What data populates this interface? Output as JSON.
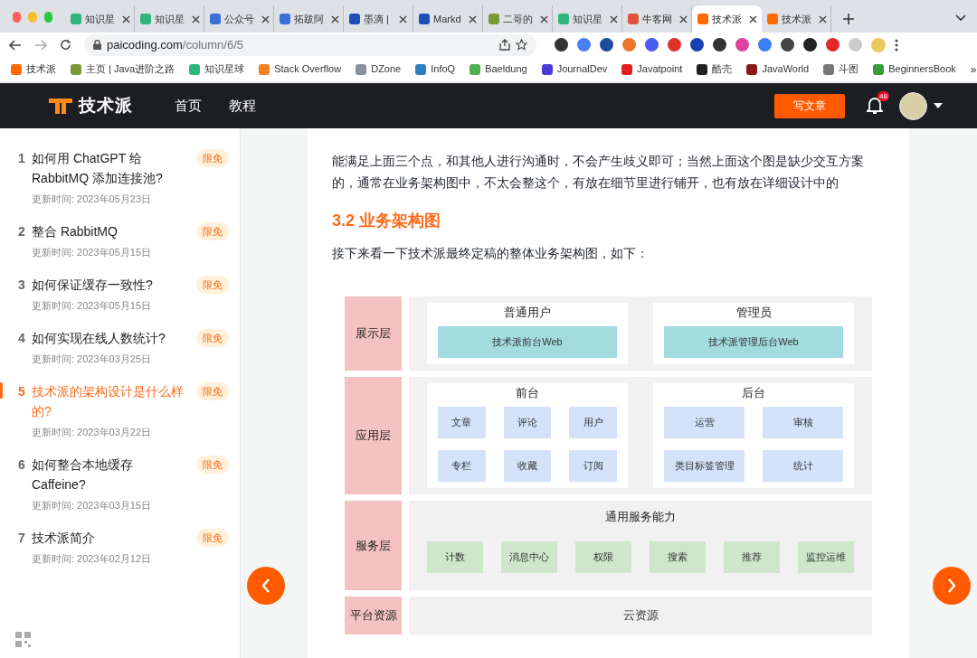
{
  "browser": {
    "tabs": [
      {
        "title": "知识星",
        "selected": false,
        "color": "#2fb67c"
      },
      {
        "title": "知识星",
        "selected": false,
        "color": "#2fb67c"
      },
      {
        "title": "公众号",
        "selected": false,
        "color": "#3b6fd8"
      },
      {
        "title": "拓跋阿",
        "selected": false,
        "color": "#3b6fd8"
      },
      {
        "title": "墨滴 |",
        "selected": false,
        "color": "#1d4fb8"
      },
      {
        "title": "Markd",
        "selected": false,
        "color": "#1d4fb8"
      },
      {
        "title": "二哥的",
        "selected": false,
        "color": "#7a9a3a"
      },
      {
        "title": "知识星",
        "selected": false,
        "color": "#2fb67c"
      },
      {
        "title": "牛客网",
        "selected": false,
        "color": "#e0533a"
      },
      {
        "title": "技术派",
        "selected": true,
        "color": "#ff6a00"
      },
      {
        "title": "技术派",
        "selected": false,
        "color": "#ff6a00"
      }
    ],
    "url_host": "paicoding.com",
    "url_path": "/column/6/5",
    "bookmarks": [
      {
        "title": "技术派",
        "color": "#ff6a00"
      },
      {
        "title": "主页 | Java进阶之路",
        "color": "#7a9a3a"
      },
      {
        "title": "知识星球",
        "color": "#2fb67c"
      },
      {
        "title": "Stack Overflow",
        "color": "#f48024"
      },
      {
        "title": "DZone",
        "color": "#8a8fa0"
      },
      {
        "title": "InfoQ",
        "color": "#2f7ec0"
      },
      {
        "title": "Baeldung",
        "color": "#4caf50"
      },
      {
        "title": "JournalDev",
        "color": "#4b3bd8"
      },
      {
        "title": "Javatpoint",
        "color": "#e02020"
      },
      {
        "title": "酷壳",
        "color": "#222222"
      },
      {
        "title": "JavaWorld",
        "color": "#8a1a1a"
      },
      {
        "title": "斗图",
        "color": "#777777"
      },
      {
        "title": "BeginnersBook",
        "color": "#3a9a3a"
      }
    ],
    "bookmarks_more": "»"
  },
  "header": {
    "logo_text": "技术派",
    "nav": [
      "首页",
      "教程"
    ],
    "write_button": "写文章",
    "notification_count": "48"
  },
  "sidebar": {
    "items": [
      {
        "number": "1",
        "title": "如何用 ChatGPT 给 RabbitMQ 添加连接池?",
        "badge": "限免",
        "updated": "更新时间: 2023年05月23日",
        "selected": false
      },
      {
        "number": "2",
        "title": "整合 RabbitMQ",
        "badge": "限免",
        "updated": "更新时间: 2023年05月15日",
        "selected": false
      },
      {
        "number": "3",
        "title": "如何保证缓存一致性?",
        "badge": "限免",
        "updated": "更新时间: 2023年05月15日",
        "selected": false
      },
      {
        "number": "4",
        "title": "如何实现在线人数统计?",
        "badge": "限免",
        "updated": "更新时间: 2023年03月25日",
        "selected": false
      },
      {
        "number": "5",
        "title": "技术派的架构设计是什么样的?",
        "badge": "限免",
        "updated": "更新时间: 2023年03月22日",
        "selected": true
      },
      {
        "number": "6",
        "title": "如何整合本地缓存 Caffeine?",
        "badge": "限免",
        "updated": "更新时间: 2023年03月15日",
        "selected": false
      },
      {
        "number": "7",
        "title": "技术派简介",
        "badge": "限免",
        "updated": "更新时间: 2023年02月12日",
        "selected": false
      }
    ]
  },
  "article": {
    "blocks": [
      {
        "kind": "paragraph",
        "text": "能满足上面三个点，和其他人进行沟通时，不会产生歧义即可；当然上面这个图是缺少交互方案的，通常在业务架构图中，不太会整这个，有放在细节里进行铺开，也有放在详细设计中的"
      },
      {
        "kind": "heading",
        "text": "3.2 业务架构图"
      },
      {
        "kind": "paragraph",
        "text": "接下来看一下技术派最终定稿的整体业务架构图，如下："
      }
    ],
    "diagram": {
      "layers": [
        {
          "label": "展示层",
          "color": "#a3dcdf",
          "groups": [
            {
              "title": "普通用户",
              "items": [
                "技术派前台Web"
              ]
            },
            {
              "title": "管理员",
              "items": [
                "技术派管理后台Web"
              ]
            }
          ]
        },
        {
          "label": "应用层",
          "color": "#d4e2fa",
          "groups": [
            {
              "title": "前台",
              "items": [
                "文章",
                "评论",
                "用户",
                "专栏",
                "收藏",
                "订阅"
              ]
            },
            {
              "title": "后台",
              "items": [
                "运营",
                "审核",
                "类目标签管理",
                "统计"
              ]
            }
          ]
        },
        {
          "label": "服务层",
          "color": "#cfe5cc",
          "groups": [
            {
              "title": "通用服务能力",
              "items": [
                "计数",
                "消息中心",
                "权限",
                "搜索",
                "推荐",
                "监控运维"
              ]
            }
          ]
        },
        {
          "label": "平台资源",
          "text": "云资源"
        }
      ]
    }
  }
}
